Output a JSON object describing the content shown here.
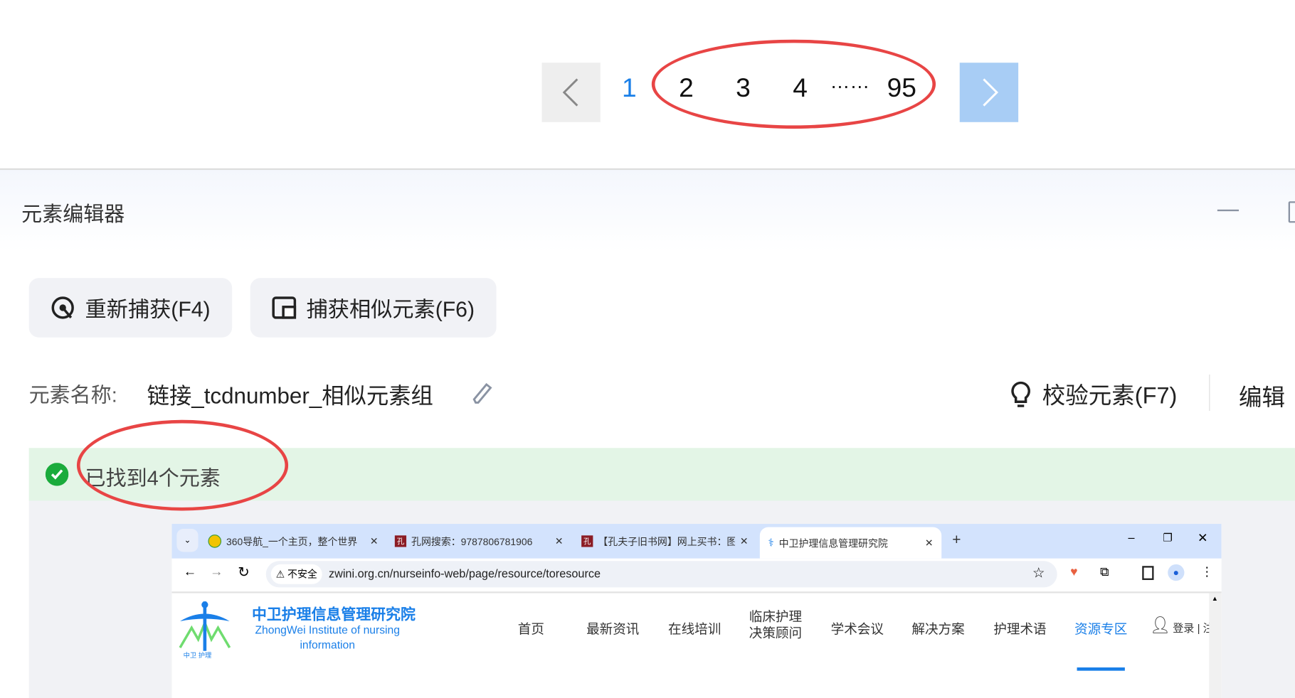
{
  "pagination": {
    "current": "1",
    "pages": [
      "2",
      "3",
      "4"
    ],
    "ellipsis": "……",
    "last": "95",
    "prev_icon": "chevron-left-icon",
    "next_icon": "chevron-right-icon"
  },
  "editor": {
    "title": "元素编辑器",
    "recapture_label": "重新捕获(F4)",
    "capture_similar_label": "捕获相似元素(F6)",
    "name_label": "元素名称:",
    "name_value": "链接_tcdnumber_相似元素组",
    "validate_label": "校验元素(F7)",
    "edit_label": "编辑",
    "status_text": "已找到4个元素"
  },
  "browser": {
    "tabs": [
      {
        "title": "360导航_一个主页，整个世界"
      },
      {
        "title": "孔网搜索：9787806781906"
      },
      {
        "title": "【孔夫子旧书网】网上买书：图"
      },
      {
        "title": "中卫护理信息管理研究院"
      }
    ],
    "security_label": "不安全",
    "url": "zwini.org.cn/nurseinfo-web/page/resource/toresource",
    "site": {
      "name_cn": "中卫护理信息管理研究院",
      "name_en": "ZhongWei Institute of nursing information",
      "nav": [
        "首页",
        "最新资讯",
        "在线培训",
        "临床护理决策顾问",
        "学术会议",
        "解决方案",
        "护理术语",
        "资源专区"
      ],
      "login": "登录 | 注"
    }
  },
  "colors": {
    "accent": "#1a7fe8",
    "annotation": "#e84545",
    "success_bg": "#e3f5e6",
    "success": "#1aab3c",
    "next_btn": "#a8cdf5"
  }
}
